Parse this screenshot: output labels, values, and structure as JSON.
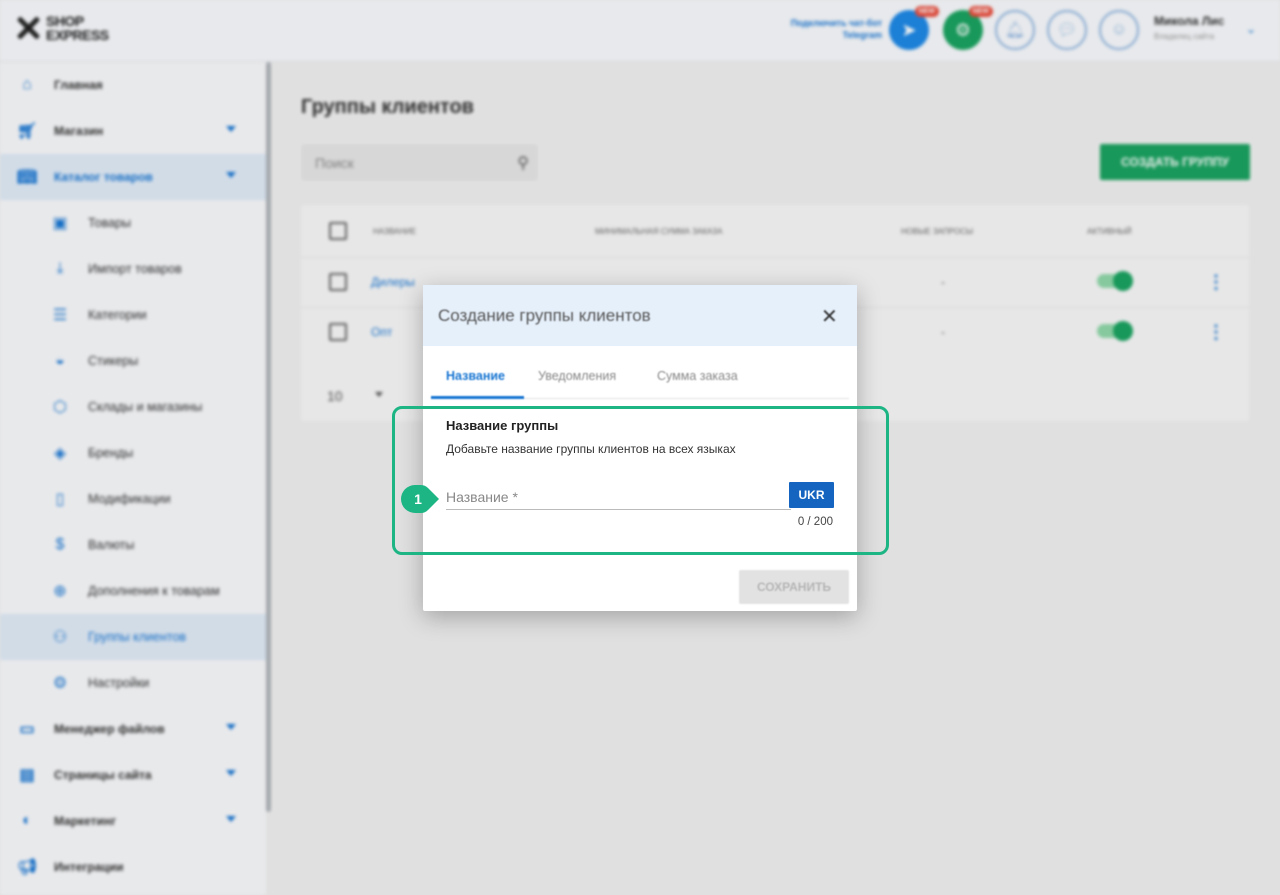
{
  "header": {
    "logo": {
      "line1": "SHOP",
      "line2": "EXPRESS"
    },
    "telegram_promo": {
      "line1": "Подключить чат-бот",
      "line2": "Telegram"
    },
    "new_badge": "NEW",
    "user": {
      "name": "Микола Лис",
      "role": "Владелец сайта"
    }
  },
  "sidebar": {
    "items": [
      {
        "label": "Главная",
        "icon": "home-icon",
        "level": "top",
        "has_chevron": false,
        "active": false
      },
      {
        "label": "Магазин",
        "icon": "cart-icon",
        "level": "top",
        "has_chevron": true,
        "active": false
      },
      {
        "label": "Каталог товаров",
        "icon": "book-icon",
        "level": "top",
        "has_chevron": true,
        "active": true
      },
      {
        "label": "Товары",
        "icon": "box-icon",
        "level": "sub",
        "active": false
      },
      {
        "label": "Импорт товаров",
        "icon": "download-icon",
        "level": "sub",
        "active": false
      },
      {
        "label": "Категории",
        "icon": "list-icon",
        "level": "sub",
        "active": false
      },
      {
        "label": "Стикеры",
        "icon": "sticker-icon",
        "level": "sub",
        "active": false
      },
      {
        "label": "Склады и магазины",
        "icon": "warehouse-icon",
        "level": "sub",
        "active": false
      },
      {
        "label": "Бренды",
        "icon": "tag-icon",
        "level": "sub",
        "active": false
      },
      {
        "label": "Модификации",
        "icon": "bookmark-icon",
        "level": "sub",
        "active": false
      },
      {
        "label": "Валюты",
        "icon": "currency-icon",
        "level": "sub",
        "active": false
      },
      {
        "label": "Дополнения к товарам",
        "icon": "plus-circle-icon",
        "level": "sub",
        "active": false
      },
      {
        "label": "Группы клиентов",
        "icon": "users-icon",
        "level": "sub",
        "active": true
      },
      {
        "label": "Настройки",
        "icon": "gear-icon",
        "level": "sub",
        "active": false
      },
      {
        "label": "Менеджер файлов",
        "icon": "folder-icon",
        "level": "top",
        "has_chevron": true,
        "active": false
      },
      {
        "label": "Страницы сайта",
        "icon": "pages-icon",
        "level": "top",
        "has_chevron": true,
        "active": false
      },
      {
        "label": "Маркетинг",
        "icon": "marketing-icon",
        "level": "top",
        "has_chevron": true,
        "active": false
      },
      {
        "label": "Интеграции",
        "icon": "megaphone-icon",
        "level": "top",
        "has_chevron": false,
        "active": false
      }
    ]
  },
  "main": {
    "title": "Группы клиентов",
    "search_placeholder": "Поиск",
    "create_button": "СОЗДАТЬ ГРУППУ",
    "table": {
      "columns": [
        "НАЗВАНИЕ",
        "МИНИМАЛЬНАЯ СУММА ЗАКАЗА",
        "НОВЫЕ ЗАПРОСЫ",
        "АКТИВНЫЙ"
      ],
      "rows": [
        {
          "name": "Дилеры",
          "new_requests": "-",
          "active": true
        },
        {
          "name": "Опт",
          "new_requests": "-",
          "active": true
        }
      ],
      "per_page": "10"
    }
  },
  "modal": {
    "title": "Создание группы клиентов",
    "tabs": [
      "Название",
      "Уведомления",
      "Сумма заказа"
    ],
    "active_tab": 0,
    "section_title": "Название группы",
    "section_desc": "Добавьте название группы клиентов на всех языках",
    "name_input": {
      "value": "",
      "placeholder": "Название *"
    },
    "lang_button": "UKR",
    "counter": "0 / 200",
    "save_button": "СОХРАНИТЬ"
  },
  "annotation": {
    "step": "1",
    "color": "#1db584"
  },
  "colors": {
    "primary": "#1976d2",
    "success": "#1aa260",
    "lang": "#1565c0"
  }
}
